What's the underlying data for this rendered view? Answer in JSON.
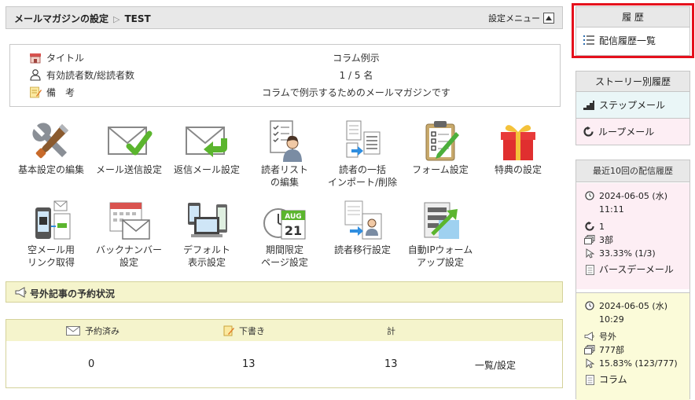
{
  "header": {
    "breadcrumb_section": "メールマガジンの設定",
    "breadcrumb_separator": "▷",
    "breadcrumb_current": "TEST",
    "settings_menu_label": "設定メニュー"
  },
  "info": {
    "title_label": "タイトル",
    "title_value": "コラム例示",
    "readers_label": "有効読者数/総読者数",
    "readers_value": "1 / 5 名",
    "note_label": "備　考",
    "note_value": "コラムで例示するためのメールマガジンです"
  },
  "features": [
    {
      "icon": "wrench-screwdriver-icon",
      "line1": "基本設定の編集",
      "line2": ""
    },
    {
      "icon": "mail-send-check-icon",
      "line1": "メール送信設定",
      "line2": ""
    },
    {
      "icon": "mail-reply-icon",
      "line1": "返信メール設定",
      "line2": ""
    },
    {
      "icon": "reader-list-icon",
      "line1": "読者リスト",
      "line2": "の編集"
    },
    {
      "icon": "import-delete-icon",
      "line1": "読者の一括",
      "line2": "インポート/削除"
    },
    {
      "icon": "form-clipboard-icon",
      "line1": "フォーム設定",
      "line2": ""
    },
    {
      "icon": "gift-icon",
      "line1": "特典の設定",
      "line2": ""
    },
    {
      "icon": "phone-link-icon",
      "line1": "空メール用",
      "line2": "リンク取得"
    },
    {
      "icon": "backnumber-calendar-icon",
      "line1": "バックナンバー",
      "line2": "設定"
    },
    {
      "icon": "devices-icon",
      "line1": "デフォルト",
      "line2": "表示設定"
    },
    {
      "icon": "limited-calendar-icon",
      "line1": "期間限定",
      "line2": "ページ設定",
      "badge_month": "AUG",
      "badge_day": "21"
    },
    {
      "icon": "reader-migrate-icon",
      "line1": "読者移行設定",
      "line2": ""
    },
    {
      "icon": "ip-warmup-icon",
      "line1": "自動IPウォーム",
      "line2": "アップ設定"
    }
  ],
  "extra_bar": {
    "title": "号外記事の予約状況"
  },
  "extra_table": {
    "col_reserved": "予約済み",
    "col_draft": "下書き",
    "col_total": "計",
    "reserved": "0",
    "draft": "13",
    "total": "13",
    "link": "一覧/設定"
  },
  "sidebar": {
    "history_title": "履 歴",
    "history_link": "配信履歴一覧",
    "story_title": "ストーリー別履歴",
    "step_mail": "ステップメール",
    "loop_mail": "ループメール",
    "recent_title": "最近10回の配信履歴",
    "recent": [
      {
        "date": "2024-06-05 (水)",
        "time": "11:11",
        "kind": "1",
        "parts": "3部",
        "rate": "33.33% (1/3)",
        "name": "バースデーメール",
        "bg": "#fdeef4"
      },
      {
        "date": "2024-06-05 (水)",
        "time": "10:29",
        "kind": "号外",
        "parts": "777部",
        "rate": "15.83% (123/777)",
        "name": "コラム",
        "bg": "#fbfbd9"
      }
    ]
  },
  "colors": {
    "highlight_frame": "#e5101c",
    "step_bg": "#eaf6f7",
    "loop_bg": "#fdeef4"
  }
}
